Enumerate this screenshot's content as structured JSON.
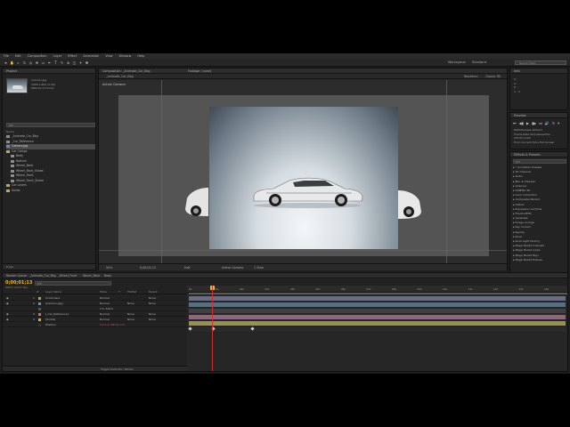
{
  "menu": [
    "File",
    "Edit",
    "Composition",
    "Layer",
    "Effect",
    "Animation",
    "View",
    "Window",
    "Help"
  ],
  "toolbar": {
    "workspace_label": "Workspace:",
    "workspace_value": "Standard",
    "help_search_placeholder": "Search Help"
  },
  "project": {
    "tab": "Project",
    "file_name": "Camaro.jpg",
    "file_line2": "1000 x 600 (1.00)",
    "file_line3": "Millions of Colors",
    "search_value": "JTP",
    "column_name": "Name",
    "items": [
      {
        "label": "_Animate_Car_Bkg",
        "type": "comp",
        "selected": false
      },
      {
        "label": "_Car_Reference",
        "type": "comp",
        "selected": false
      },
      {
        "label": "Camaro.jpg",
        "type": "img",
        "selected": true
      },
      {
        "label": "Car Comps",
        "type": "folder",
        "selected": false
      },
      {
        "label": "Body",
        "type": "comp",
        "selected": false
      },
      {
        "label": "Bottom",
        "type": "comp",
        "selected": false
      },
      {
        "label": "Wheel_Back",
        "type": "comp",
        "selected": false
      },
      {
        "label": "Wheel_Back_Shake",
        "type": "comp",
        "selected": false
      },
      {
        "label": "Wheel_Front",
        "type": "comp",
        "selected": false
      },
      {
        "label": "Wheel_Front_Shake",
        "type": "comp",
        "selected": false
      },
      {
        "label": "Car Layers",
        "type": "folder",
        "selected": false
      },
      {
        "label": "Solids",
        "type": "folder",
        "selected": false
      }
    ],
    "footer": "8 bpc"
  },
  "composition": {
    "tabs": [
      "Composition: _Animate_Car_Bkg",
      "Footage: (none)"
    ],
    "sub_tab": "_Animate_Car_Bkg",
    "active_camera": "Active Camera",
    "renderer_label": "Renderer:",
    "renderer_value": "Classic 3D",
    "footer": {
      "zoom": "50%",
      "timecode": "0;00;01;13",
      "resolution": "Half",
      "camera": "Active Camera",
      "views": "1 View"
    }
  },
  "info": {
    "tab": "Info",
    "lines": [
      "R :",
      "G :",
      "B :",
      "A : 0"
    ]
  },
  "preview": {
    "tab": "Preview",
    "controls": [
      "⏮",
      "◀▮",
      "▶",
      "▮▶",
      "⏭",
      "🔊",
      "↻",
      "⏵"
    ],
    "ram_preview": "RAM Preview Options",
    "frame_rate": "Frame Rate",
    "skip": "Skip",
    "resolution": "Resolution",
    "frame_rate_value": "(29.97)",
    "resolution_value": "Auto",
    "from_current_time": "From Current Time",
    "full_screen": "Full Screen"
  },
  "effects": {
    "tab": "Effects & Presets",
    "search_value": "JTP",
    "items": [
      "▸ * Animation Presets",
      "▸ 3D Channel",
      "▸ Audio",
      "▸ Blur & Sharpen",
      "▸ Channel",
      "▸ CINEMA 4D",
      "▸ Color Correction",
      "▸ Composite Wizard",
      "▸ Distort",
      "▸ Expression Controls",
      "▸ FrischluftTM",
      "▸ Generate",
      "▸ Image Lounge",
      "▸ Key Correct",
      "▸ Keying",
      "▸ Knoll",
      "▸ Knoll Light Factory",
      "▸ Magic Bullet Colorista",
      "▸ Magic Bullet Looks",
      "▸ Magic Bullet Mojo",
      "▸ Magic Bullet Frames"
    ]
  },
  "timeline": {
    "tabs": [
      "Render Queue",
      "_Animate_Car_Bkg",
      "_Wheel_Front",
      "Wheel_Back",
      "Body"
    ],
    "timecode": "0;00;01;13",
    "timecode_sub": "00043 (29.97 fps)",
    "search_value": "JTP",
    "columns": [
      "#",
      "Layer Name",
      "Mode",
      "T",
      "TrkMat",
      "Parent"
    ],
    "layers": [
      {
        "num": "1",
        "name": "Controllers",
        "mode": "Normal",
        "trkmat": "",
        "parent": "None",
        "color": "#b0a070"
      },
      {
        "num": "2",
        "name": "[Camaro.jpg]",
        "mode": "Normal",
        "trkmat": "None",
        "parent": "None",
        "color": "#7090b0"
      },
      {
        "num": "",
        "name": "",
        "mode": "1.5, 500.0",
        "trkmat": "",
        "parent": "",
        "color": "#555555"
      },
      {
        "num": "3",
        "name": "[_Car_Reference]",
        "mode": "Normal",
        "trkmat": "None",
        "parent": "None",
        "color": "#b07a90"
      },
      {
        "num": "4",
        "name": "[Solids]",
        "mode": "Normal",
        "trkmat": "None",
        "parent": "None",
        "color": "#c8b040"
      },
      {
        "num": "",
        "name": "Position",
        "mode": "1711.0, 387.6, 0.0",
        "trkmat": "",
        "parent": "",
        "color": "#333333"
      }
    ],
    "ruler_ticks": [
      "0s",
      "01s",
      "02s",
      "03s",
      "04s",
      "05s",
      "06s",
      "07s",
      "08s",
      "09s",
      "10s",
      "11s",
      "12s",
      "13s",
      "14s"
    ],
    "footer": "Toggle Switches / Modes"
  },
  "colors": {
    "timecode": "#e8b830",
    "playhead": "#d03030",
    "guide": "#5560a8"
  }
}
